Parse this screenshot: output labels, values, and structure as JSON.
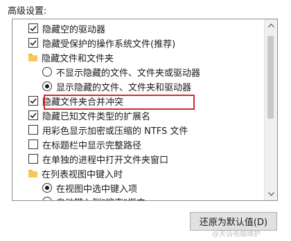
{
  "section_title": "高级设置:",
  "items": [
    {
      "type": "checkbox",
      "checked": true,
      "label": "隐藏空的驱动器"
    },
    {
      "type": "checkbox",
      "checked": true,
      "label": "隐藏受保护的操作系统文件(推荐)"
    },
    {
      "type": "folder",
      "label": "隐藏文件和文件夹"
    },
    {
      "type": "radio",
      "checked": false,
      "label": "不显示隐藏的文件、文件夹或驱动器"
    },
    {
      "type": "radio",
      "checked": true,
      "label": "显示隐藏的文件、文件夹和驱动器"
    },
    {
      "type": "checkbox",
      "checked": true,
      "label": "隐藏文件夹合并冲突"
    },
    {
      "type": "checkbox",
      "checked": true,
      "label": "隐藏已知文件类型的扩展名"
    },
    {
      "type": "checkbox",
      "checked": false,
      "label": "用彩色显示加密或压缩的 NTFS 文件"
    },
    {
      "type": "checkbox",
      "checked": false,
      "label": "在标题栏中显示完整路径"
    },
    {
      "type": "checkbox",
      "checked": false,
      "label": "在单独的进程中打开文件夹窗口"
    },
    {
      "type": "folder",
      "label": "在列表视图中键入时"
    },
    {
      "type": "radio",
      "checked": true,
      "label": "在视图中选中键入项"
    },
    {
      "type": "radio",
      "checked": false,
      "label": "自动键入到\"搜索\"框中"
    }
  ],
  "restore_button": "还原为默认值(D)",
  "watermark": "@天话电脑维护"
}
